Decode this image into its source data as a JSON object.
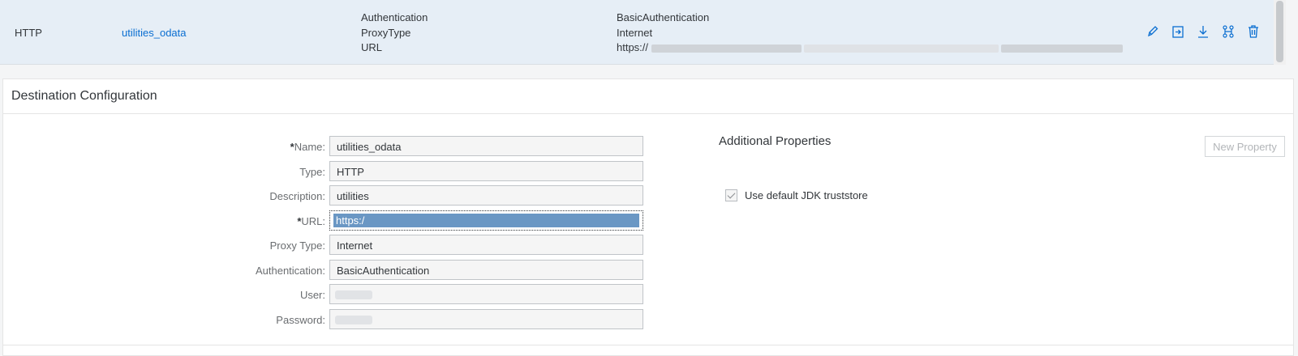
{
  "destination_row": {
    "type": "HTTP",
    "name": "utilities_odata",
    "property_labels": [
      "Authentication",
      "ProxyType",
      "URL"
    ],
    "property_values": [
      "BasicAuthentication",
      "Internet",
      "https://"
    ]
  },
  "actions": [
    {
      "name": "edit-icon"
    },
    {
      "name": "clone-icon"
    },
    {
      "name": "export-icon"
    },
    {
      "name": "check-connection-icon"
    },
    {
      "name": "delete-icon"
    }
  ],
  "panel": {
    "title": "Destination Configuration"
  },
  "form": {
    "name_label": "Name:",
    "name_value": "utilities_odata",
    "type_label": "Type:",
    "type_value": "HTTP",
    "description_label": "Description:",
    "description_value": "utilities",
    "url_label": "URL:",
    "url_value": "https:/",
    "proxy_type_label": "Proxy Type:",
    "proxy_type_value": "Internet",
    "authentication_label": "Authentication:",
    "authentication_value": "BasicAuthentication",
    "user_label": "User:",
    "password_label": "Password:",
    "required_marker": "*"
  },
  "additional": {
    "title": "Additional Properties",
    "new_property_button": "New Property",
    "truststore_label": "Use default JDK truststore",
    "truststore_checked": true
  }
}
